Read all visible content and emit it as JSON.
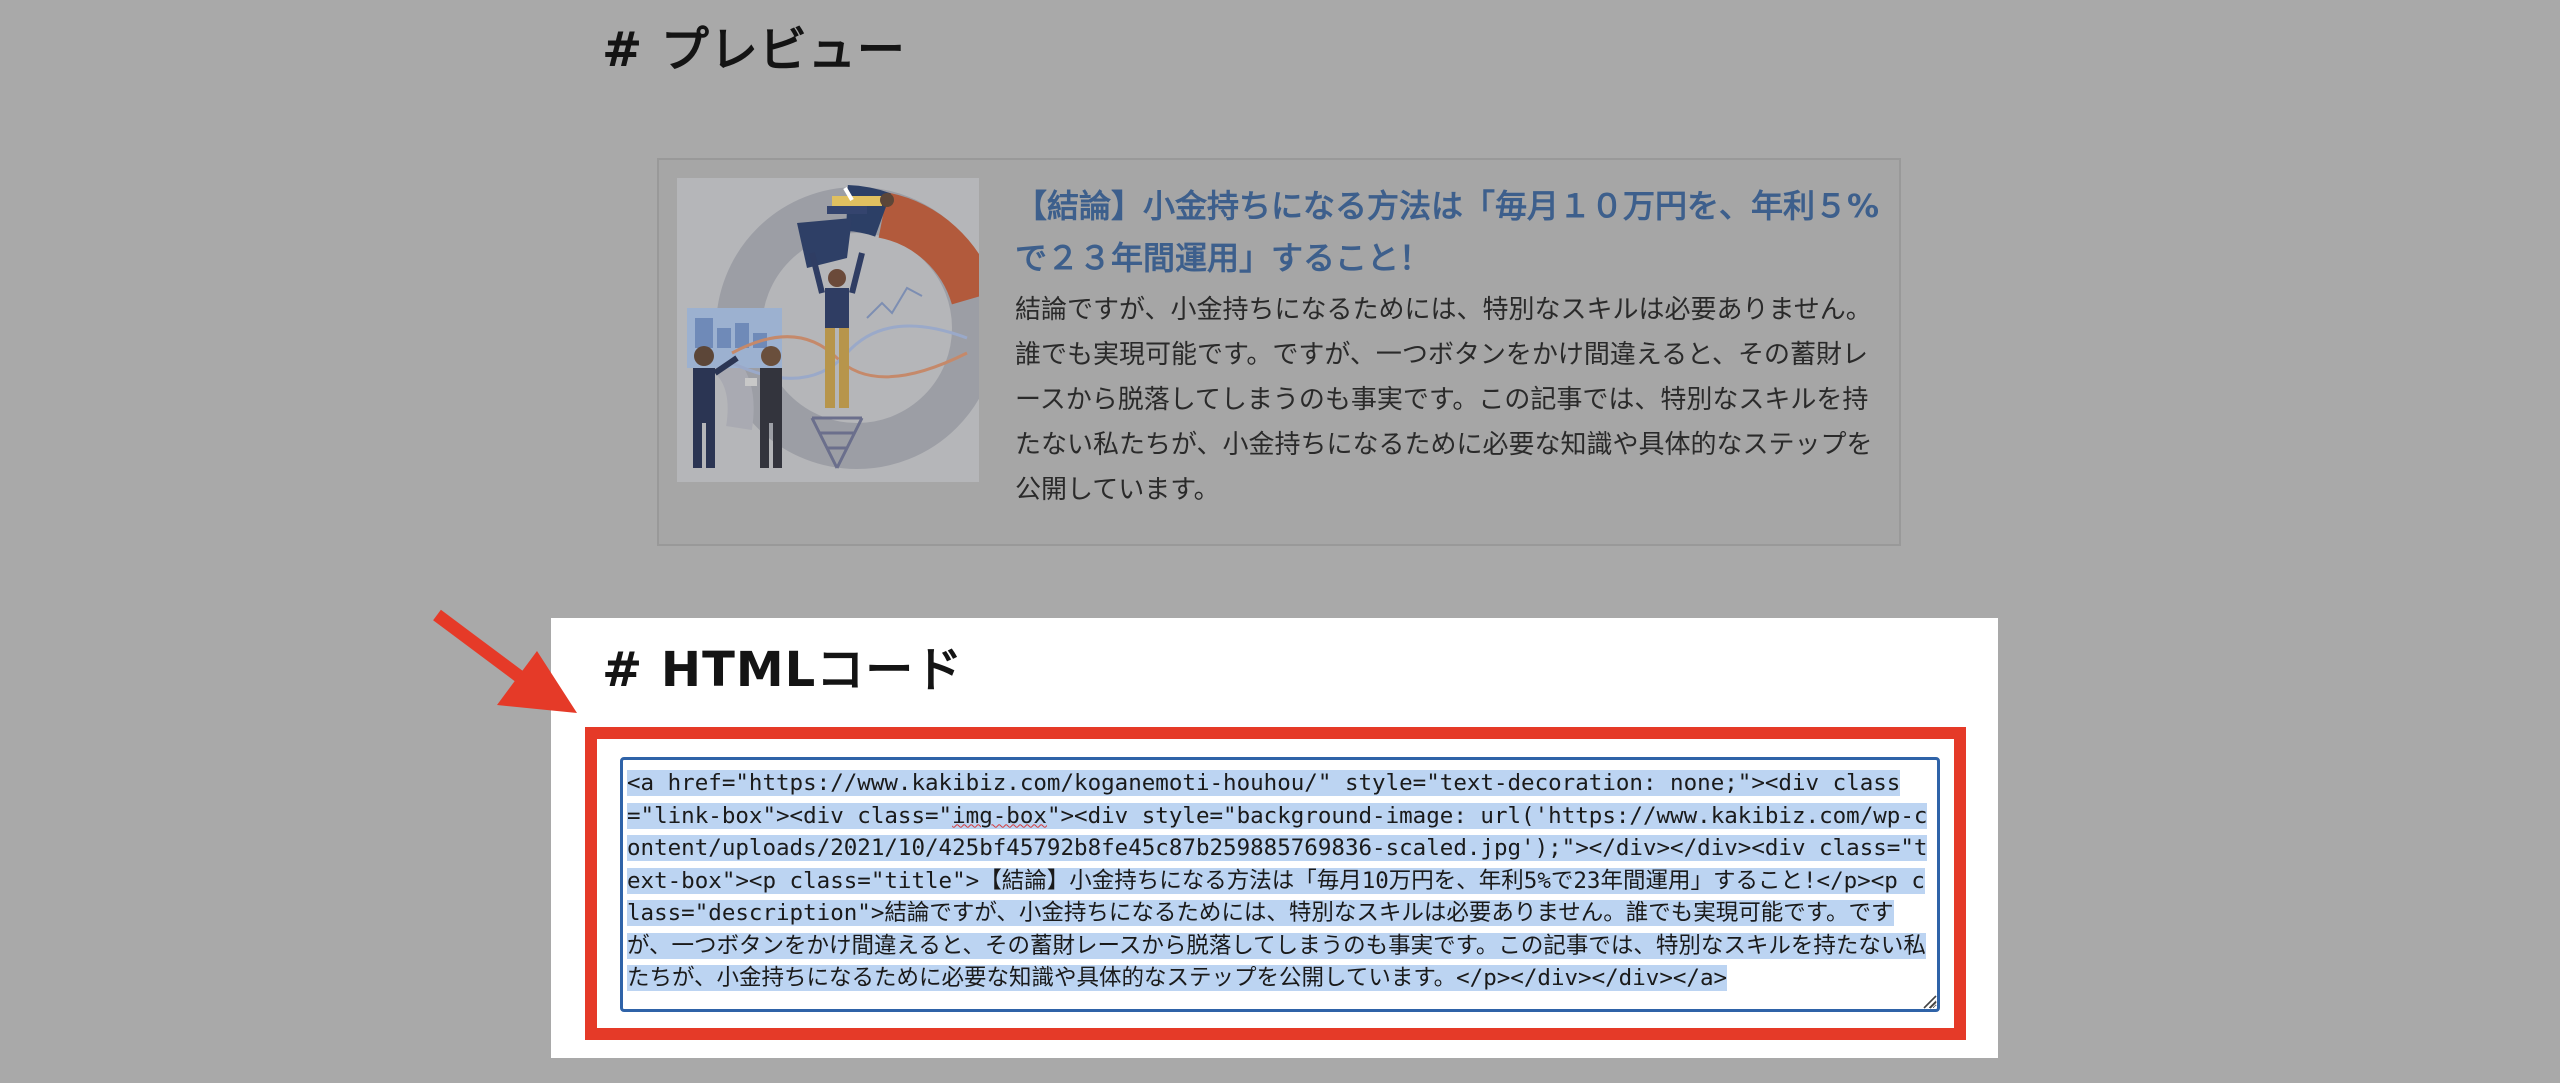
{
  "preview": {
    "heading": "# プレビュー",
    "card": {
      "href": "https://www.kakibiz.com/koganemoti-houhou/",
      "title": "【結論】小金持ちになる方法は「毎月１０万円を、年利５%で２３年間運用」すること！",
      "description": "結論ですが、小金持ちになるためには、特別なスキルは必要ありません。誰でも実現可能です。ですが、一つボタンをかけ間違えると、その蓄財レースから脱落してしまうのも事実です。この記事では、特別なスキルを持たない私たちが、小金持ちになるために必要な知識や具体的なステップを公開しています。",
      "image_icon": "business-people-chart-illustration"
    }
  },
  "html_code": {
    "heading": "# HTMLコード",
    "code_before_mark": "<a href=\"https://www.kakibiz.com/koganemoti-houhou/\" style=\"text-decoration: none;\"><div class=\"link-box\"><div class=\"",
    "code_marked_word": "img-box",
    "code_after_mark": "\"><div style=\"background-image: url('https://www.kakibiz.com/wp-content/uploads/2021/10/425bf45792b8fe45c87b259885769836-scaled.jpg');\"></div></div><div class=\"text-box\"><p class=\"title\">【結論】小金持ちになる方法は「毎月10万円を、年利5%で23年間運用」すること!</p><p class=\"description\">結論ですが、小金持ちになるためには、特別なスキルは必要ありません。誰でも実現可能です。ですが、一つボタンをかけ間違えると、その蓄財レースから脱落してしまうのも事実です。この記事では、特別なスキルを持たない私たちが、小金持ちになるために必要な知識や具体的なステップを公開しています。</p></div></div></a>",
    "arrow_icon": "red-arrow-icon"
  },
  "colors": {
    "overlay": "#a9a9a9",
    "highlight_frame": "#e53a28",
    "card_title": "#3d5f8c",
    "selection": "#bcd4f2",
    "textarea_focus_border": "#2f63a8"
  }
}
